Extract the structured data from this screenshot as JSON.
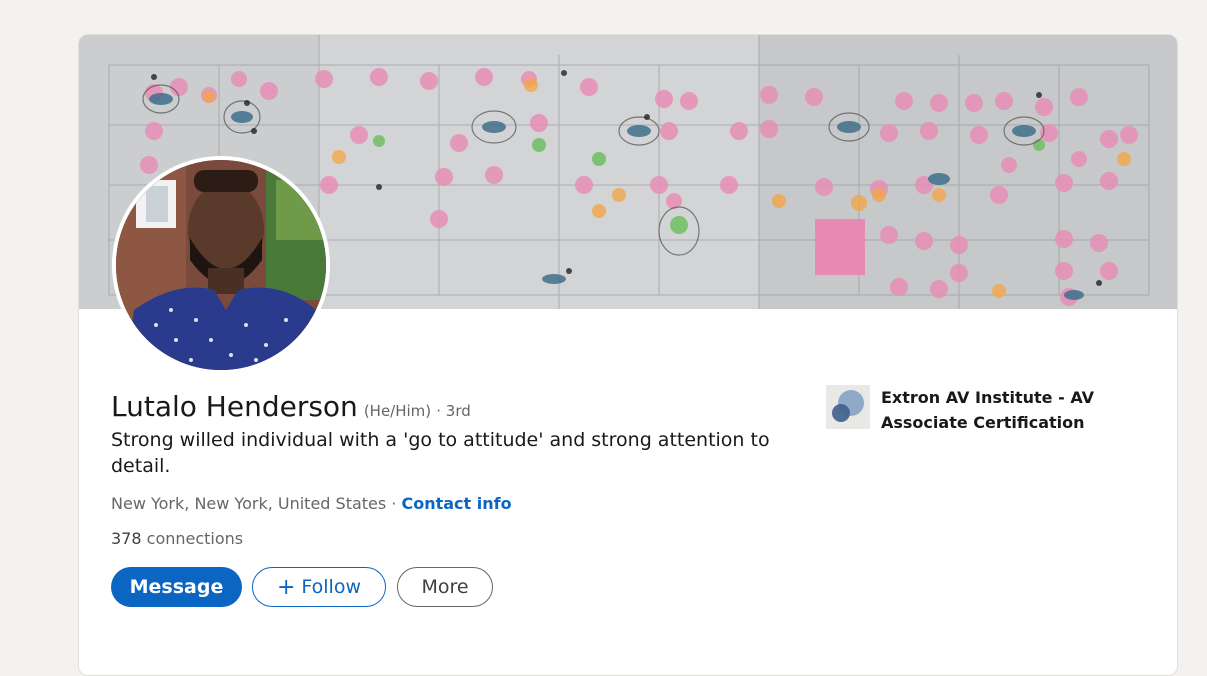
{
  "profile": {
    "name": "Lutalo Henderson",
    "pronouns": "(He/Him)",
    "degree": "· 3rd",
    "headline": "Strong willed individual with a 'go to attitude' and strong attention to detail.",
    "location": "New York, New York, United States ·",
    "contact_info": "Contact info",
    "connections_count": "378",
    "connections_label": "connections"
  },
  "actions": {
    "message": "Message",
    "follow": "Follow",
    "more": "More"
  },
  "education": {
    "name": "Extron AV Institute - AV Associate Certification"
  },
  "colors": {
    "accent": "#0a66c2",
    "page_bg": "#f3f2ef",
    "text_primary": "#191919",
    "text_secondary": "#666666"
  },
  "icons": {
    "follow": "plus-icon",
    "education_logo": "overlapping-circles-icon"
  }
}
